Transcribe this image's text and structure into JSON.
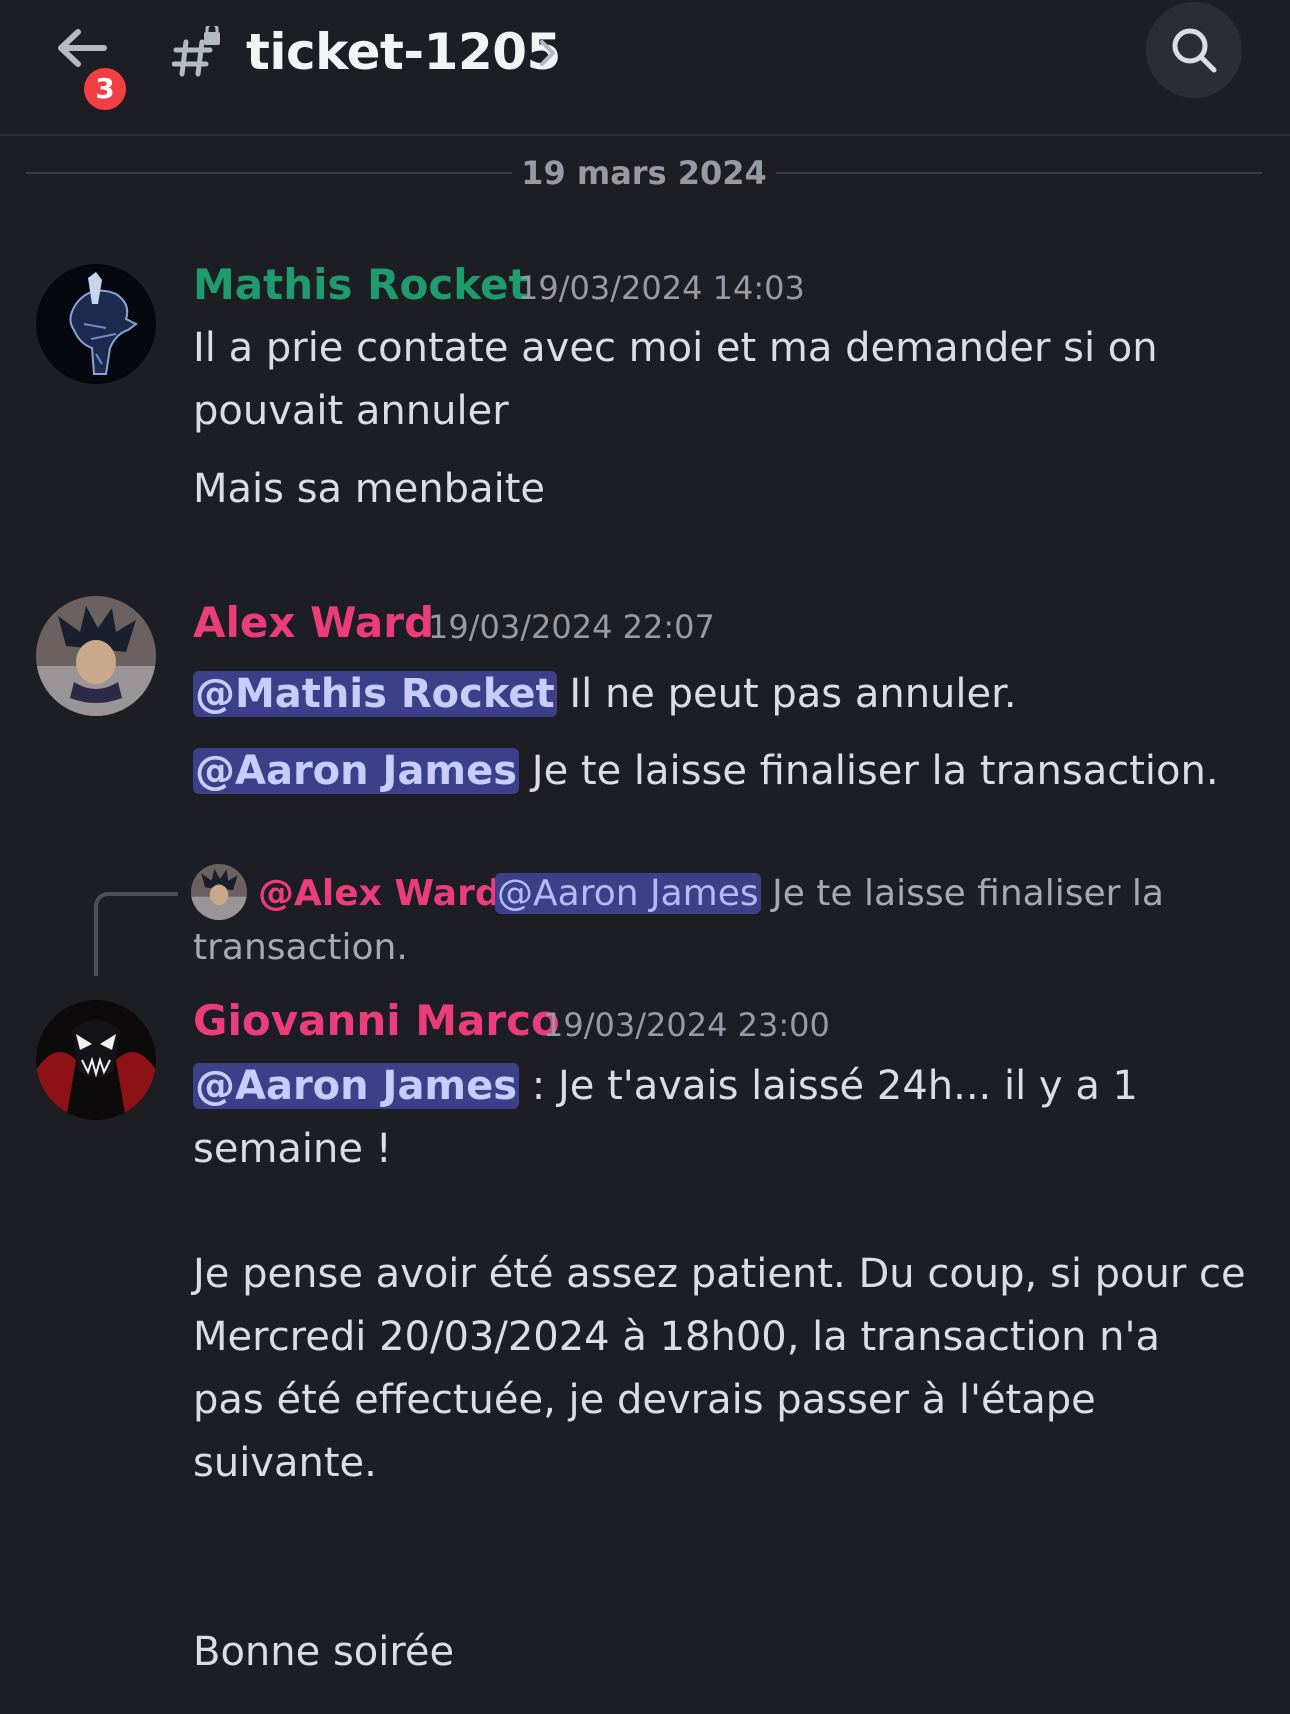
{
  "header": {
    "back_badge": "3",
    "channel_name": "ticket-1205",
    "icons": [
      "back-arrow-icon",
      "locked-channel-icon",
      "chevron-right-icon",
      "search-icon"
    ]
  },
  "date_divider": "19 mars 2024",
  "messages": [
    {
      "author": "Mathis Rocket",
      "author_color": "#1f9c6e",
      "timestamp": "19/03/2024 14:03",
      "lines": [
        "Il a prie contate avec moi et ma demander si on",
        "pouvait annuler"
      ],
      "line2": "Mais sa menbaite"
    },
    {
      "author": "Alex Ward",
      "author_color": "#eb3d7a",
      "timestamp": "19/03/2024 22:07",
      "line1_mention": "@Mathis Rocket",
      "line1_text": " Il ne peut pas annuler.",
      "line2_mention": "@Aaron James",
      "line2_text": " Je te laisse finaliser la transaction."
    },
    {
      "reply": {
        "author": "@Alex Ward",
        "mention": "@Aaron James",
        "text": " Je te laisse finaliser la",
        "text2": "transaction."
      },
      "author": "Giovanni Marco",
      "author_color": "#eb3d7a",
      "timestamp": "19/03/2024 23:00",
      "line1_mention": "@Aaron James",
      "line1_text": " : Je t'avais laissé 24h... il y a 1",
      "line2": "semaine !",
      "para": [
        "Je pense avoir été assez patient. Du coup, si pour ce",
        "Mercredi 20/03/2024 à 18h00, la transaction n'a",
        "pas été effectuée, je devrais passer à l'étape",
        "suivante."
      ],
      "closing": "Bonne soirée"
    }
  ]
}
